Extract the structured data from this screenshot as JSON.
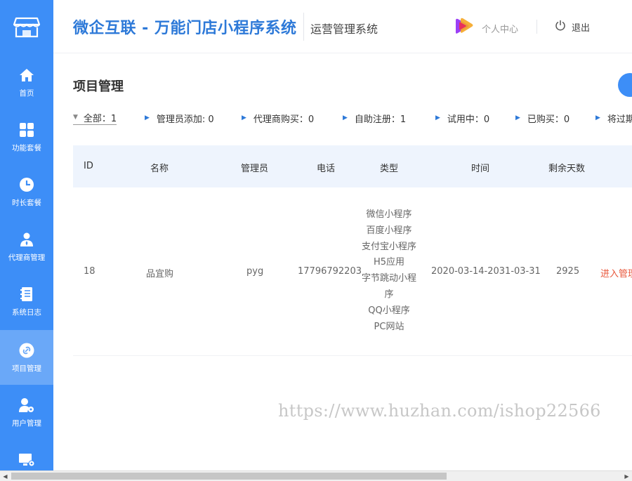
{
  "sidebar": {
    "items": [
      {
        "label": "首页",
        "icon": "home-icon"
      },
      {
        "label": "功能套餐",
        "icon": "grid-icon"
      },
      {
        "label": "时长套餐",
        "icon": "clock-icon"
      },
      {
        "label": "代理商管理",
        "icon": "agent-icon"
      },
      {
        "label": "系统日志",
        "icon": "log-icon"
      },
      {
        "label": "项目管理",
        "icon": "link-icon",
        "active": true
      },
      {
        "label": "用户管理",
        "icon": "user-gear-icon"
      }
    ],
    "bg_color": "#3d8ef7",
    "active_color": "#6aa8f8"
  },
  "header": {
    "brand": "微企互联 - 万能门店小程序系统",
    "subtitle": "运营管理系统",
    "user_center": "个人中心",
    "logout": "退出",
    "brand_color": "#2d79d8"
  },
  "main": {
    "title": "项目管理",
    "filters": [
      "全部：1",
      "管理员添加: 0",
      "代理商购买：0",
      "自助注册：1",
      "试用中：0",
      "已购买：0",
      "将过期"
    ],
    "table": {
      "headers": [
        "ID",
        "名称",
        "管理员",
        "电话",
        "类型",
        "时间",
        "剩余天数"
      ],
      "rows": [
        {
          "id": "18",
          "name": "品宜购",
          "admin": "pyg",
          "phone": "17796792203",
          "types": [
            "微信小程序",
            "百度小程序",
            "支付宝小程序",
            "H5应用",
            "字节跳动小程",
            "序",
            "QQ小程序",
            "PC网站"
          ],
          "time": "2020-03-14-2031-03-31",
          "days": "2925",
          "action": "进入管理"
        }
      ]
    }
  },
  "watermark": "https://www.huzhan.com/ishop22566",
  "accent_color": "#e8573b"
}
